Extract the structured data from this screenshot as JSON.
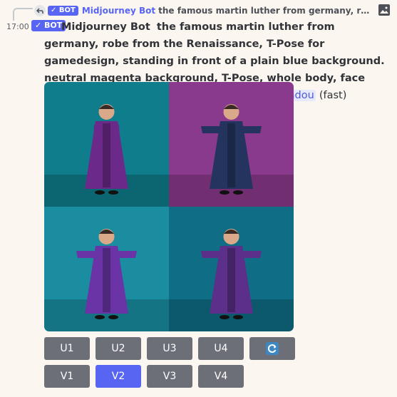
{
  "reply": {
    "badge": "✓ BOT",
    "author": "Midjourney Bot",
    "preview": "the famous martin luther from germany, robe fro..."
  },
  "message": {
    "timestamp": "17:00",
    "badge": "✓ BOT",
    "author": "Midjourney Bot",
    "prompt": "the famous martin luther from germany, robe from the Renaissance, T-Pose for gamedesign, standing in front of a plain blue background. neutral magenta background, T-Pose, whole body, face looking in the camera, color film -",
    "mention": "@AceWindou",
    "speed": "(fast)"
  },
  "images": [
    {
      "bg": "#0f7d8c",
      "robe": "#6b2a8a",
      "pose": "down"
    },
    {
      "bg": "#8a3a8c",
      "robe": "#24345e",
      "pose": "t"
    },
    {
      "bg": "#1a8ea0",
      "robe": "#6a34a6",
      "pose": "t"
    },
    {
      "bg": "#0f6d86",
      "robe": "#5c2f8a",
      "pose": "t"
    }
  ],
  "upscale_buttons": [
    "U1",
    "U2",
    "U3",
    "U4"
  ],
  "variation_buttons": [
    "V1",
    "V2",
    "V3",
    "V4"
  ],
  "colors": {
    "active": "#5865f2",
    "button": "#6d6f78"
  }
}
